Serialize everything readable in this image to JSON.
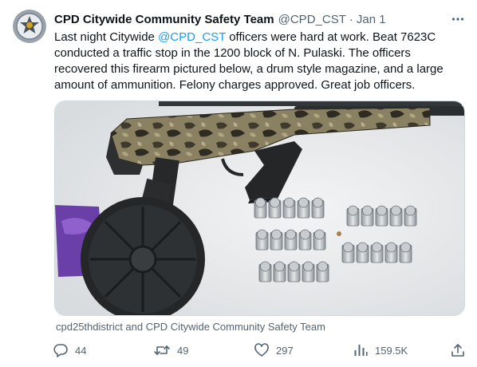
{
  "tweet": {
    "author": {
      "display_name": "CPD Citywide Community Safety Team",
      "handle": "@CPD_CST",
      "separator": "·",
      "date": "Jan 1",
      "avatar_icon": "police-star-badge"
    },
    "text_parts": {
      "before_mention": "Last night Citywide ",
      "mention": "@CPD_CST",
      "after_mention": " officers were hard at work. Beat 7623C conducted a traffic stop in the 1200 block of N. Pulaski. The officers recovered this firearm pictured below, a drum style magazine, and a large amount of ammunition. Felony charges approved. Great job officers."
    },
    "media_description_icon": "photo-firearm-drum-magazine-ammunition",
    "tagged_users": "cpd25thdistrict and CPD Citywide Community Safety Team",
    "metrics": {
      "replies": "44",
      "retweets": "49",
      "likes": "297",
      "views": "159.5K"
    },
    "icons": {
      "more": "more-icon",
      "reply": "reply-icon",
      "retweet": "retweet-icon",
      "like": "heart-icon",
      "views": "views-icon",
      "share": "share-icon"
    },
    "colors": {
      "text": "#0f1419",
      "secondary": "#536471",
      "accent": "#1d9bf0",
      "border": "#cfd9de"
    }
  }
}
